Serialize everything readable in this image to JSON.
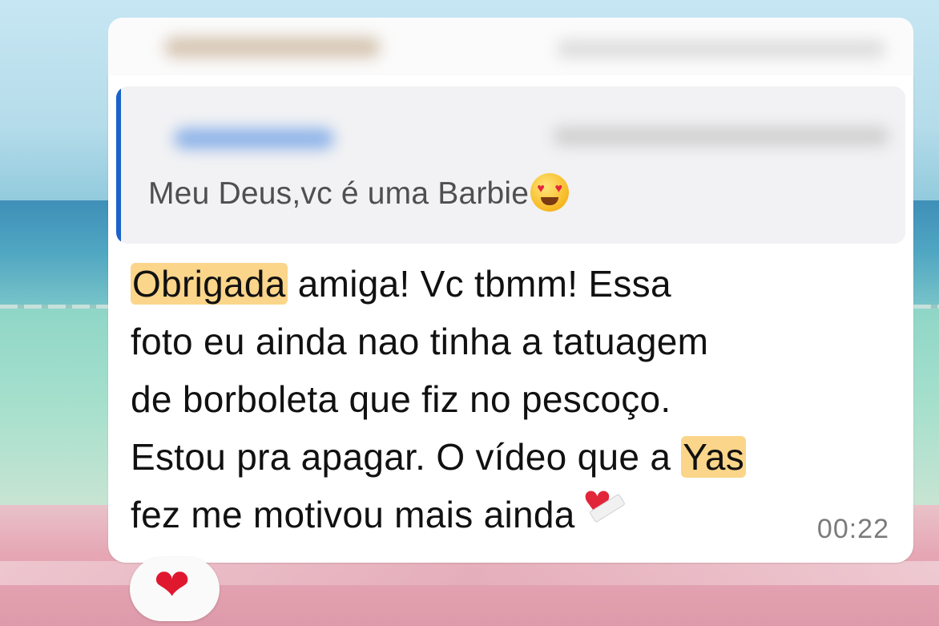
{
  "chat": {
    "quoted_message": {
      "text": "Meu Deus,vc é uma Barbie",
      "emoji": "smiling-face-with-heart-eyes"
    },
    "message": {
      "lines": [
        {
          "highlight": "Obrigada",
          "rest": " amiga! Vc tbmm! Essa"
        },
        {
          "text": "foto eu ainda nao tinha a tatuagem"
        },
        {
          "text": "de borboleta que fiz no pescoço."
        },
        {
          "text": "Estou pra apagar. O vídeo que a ",
          "highlight": "Yas"
        },
        {
          "text": "fez me motivou mais ainda"
        }
      ],
      "trailing_emoji": "mending-heart",
      "time": "00:22"
    },
    "reaction": {
      "emoji": "red-heart",
      "glyph": "❤"
    }
  },
  "colors": {
    "quote_bar": "#1a63c9",
    "highlight": "#fbd58a",
    "reaction_heart": "#e0182f"
  }
}
